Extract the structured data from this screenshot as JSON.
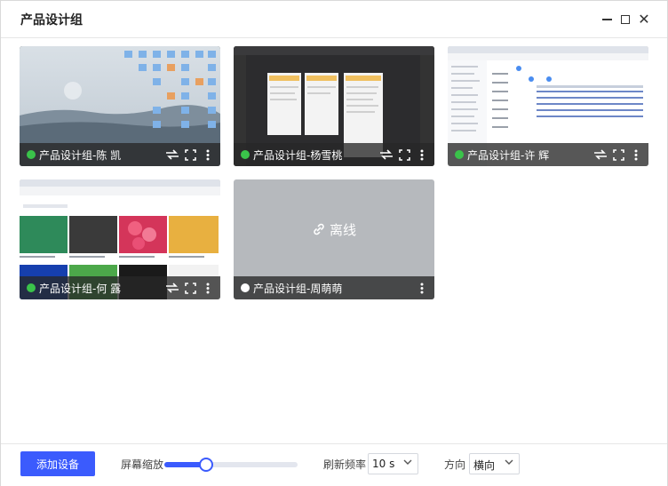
{
  "window": {
    "title": "产品设计组",
    "minimize_icon": "minimize-icon",
    "maximize_icon": "maximize-icon",
    "close_icon": "close-icon",
    "close_glyph": "✕"
  },
  "devices": [
    {
      "name": "产品设计组-陈   凯",
      "status": "online",
      "status_color": "#3ac34a"
    },
    {
      "name": "产品设计组-杨雪桃",
      "status": "online",
      "status_color": "#3ac34a"
    },
    {
      "name": "产品设计组-许   辉",
      "status": "online",
      "status_color": "#3ac34a"
    },
    {
      "name": "产品设计组-何   露",
      "status": "online",
      "status_color": "#3ac34a"
    },
    {
      "name": "产品设计组-周萌萌",
      "status": "offline",
      "status_color": "#ffffff",
      "offline_label": "离线"
    }
  ],
  "footer": {
    "add_device_label": "添加设备",
    "zoom_label": "屏幕缩放",
    "zoom_level": 0.31,
    "refresh_label": "刷新频率",
    "refresh_value": "10 s",
    "direction_label": "方向",
    "direction_value": "横向"
  },
  "colors": {
    "accent": "#3b5bfd",
    "online": "#3ac34a"
  }
}
